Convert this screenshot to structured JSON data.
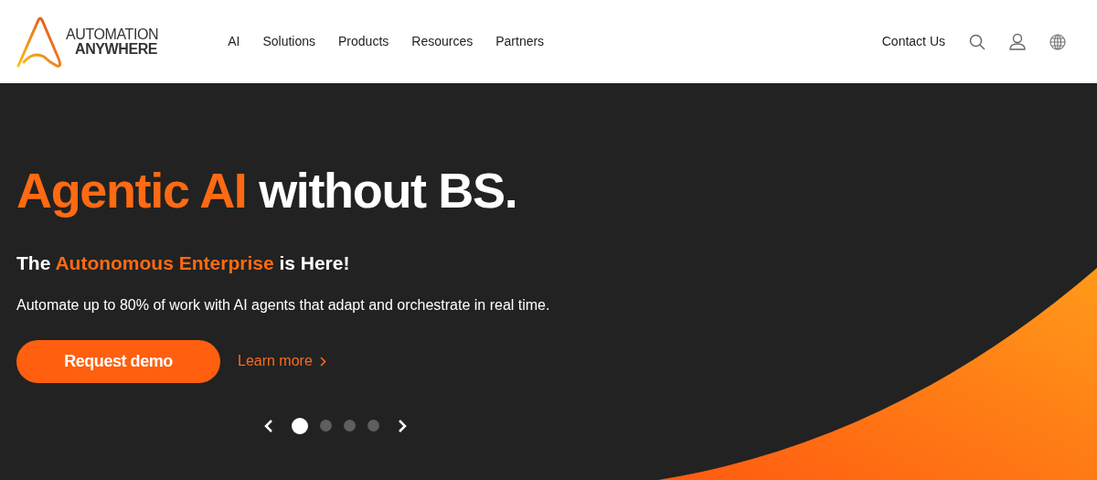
{
  "header": {
    "logo": {
      "line_1": "AUTOMATION",
      "line_2": "ANYWHERE"
    },
    "nav": [
      "AI",
      "Solutions",
      "Products",
      "Resources",
      "Partners"
    ],
    "contact": "Contact Us"
  },
  "hero": {
    "headline": [
      {
        "text": "Agentic AI",
        "highlight": true
      },
      {
        "text": " without BS.",
        "highlight": false
      }
    ],
    "subheading": [
      {
        "text": "The ",
        "highlight": false
      },
      {
        "text": "Autonomous Enterprise",
        "highlight": true
      },
      {
        "text": " is Here!",
        "highlight": false
      }
    ],
    "description": "Automate up to 80% of work with AI agents that adapt and orchestrate in real time.",
    "primary_button": "Request demo",
    "secondary_link": "Learn more",
    "slides": [
      {
        "selected": true
      },
      {
        "selected": false
      },
      {
        "selected": false
      },
      {
        "selected": false
      }
    ]
  }
}
